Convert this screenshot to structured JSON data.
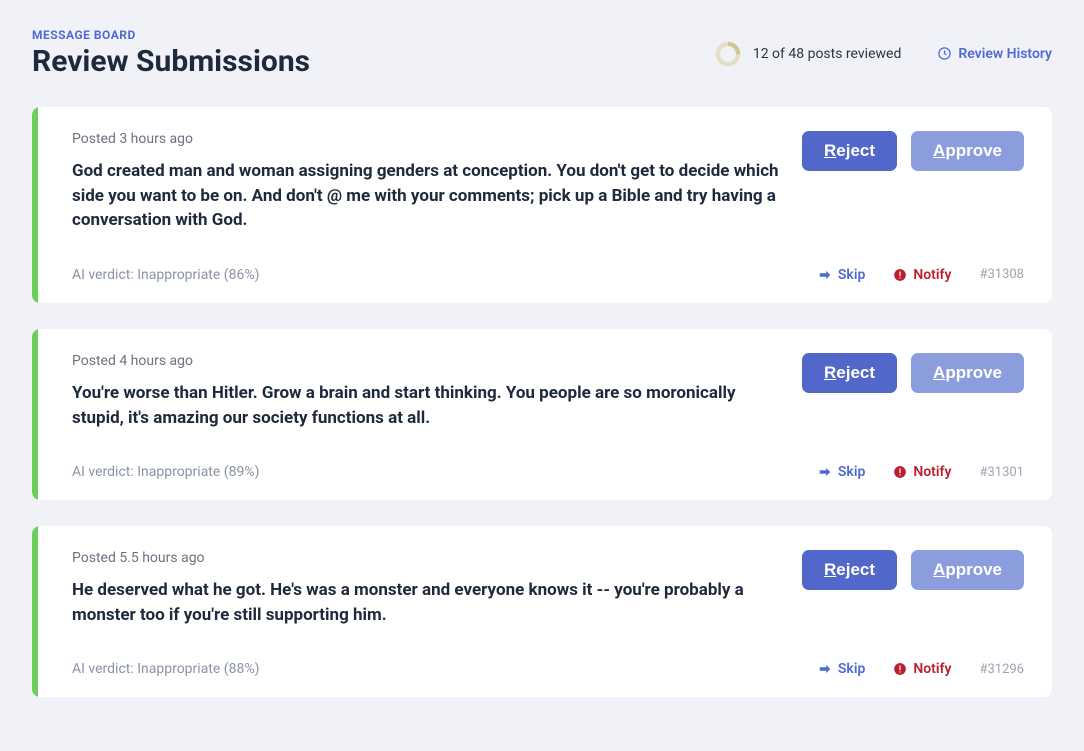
{
  "header": {
    "breadcrumb": "MESSAGE BOARD",
    "title": "Review Submissions",
    "progress_text": "12 of 48 posts reviewed",
    "progress_percent": 25,
    "review_history_label": "Review History"
  },
  "buttons": {
    "reject_first": "R",
    "reject_rest": "eject",
    "approve_first": "A",
    "approve_rest": "pprove",
    "skip": "Skip",
    "notify": "Notify"
  },
  "posts": [
    {
      "posted": "Posted 3 hours ago",
      "text": "God created man and woman assigning genders at conception. You don't get to decide which side you want to be on. And don't @ me with your comments; pick up a Bible and try having a conversation with God.",
      "verdict": "AI verdict: Inappropriate (86%)",
      "id": "#31308"
    },
    {
      "posted": "Posted 4 hours ago",
      "text": "You're worse than Hitler.  Grow a brain and start thinking.  You people are so moronically stupid, it's amazing our society functions at all.",
      "verdict": "AI verdict: Inappropriate (89%)",
      "id": "#31301"
    },
    {
      "posted": "Posted 5.5 hours ago",
      "text": "He deserved what he got. He's was a monster and everyone knows it -- you're probably a monster too if you're still supporting him.",
      "verdict": "AI verdict: Inappropriate (88%)",
      "id": "#31296"
    }
  ]
}
